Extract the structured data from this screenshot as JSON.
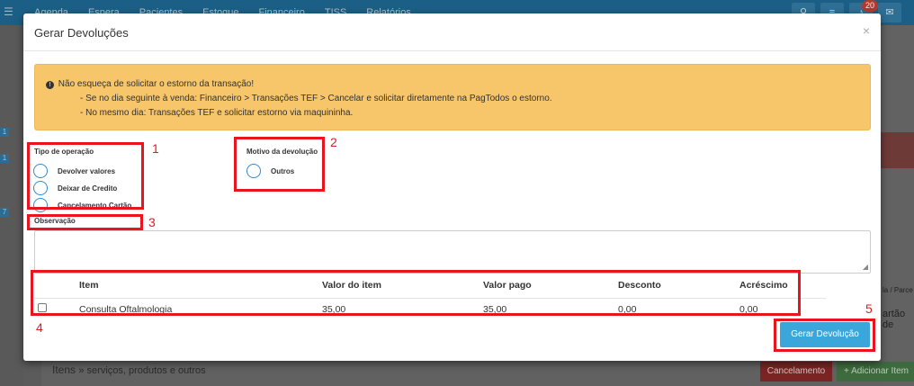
{
  "topbar": {
    "nav": [
      "Agenda",
      "Espera",
      "Pacientes",
      "Estoque",
      "Financeiro",
      "TISS",
      "Relatórios"
    ],
    "notification_count": "20"
  },
  "background": {
    "itens_label": "Itens",
    "itens_sub": "» serviços, produtos e outros",
    "cancel_label": "Cancelamento",
    "add_label": "+ Adicionar Item ▾",
    "right_text_1": "la / Parce",
    "right_text_2": "artão de",
    "sidebar_numbers": [
      "1",
      "1",
      "7"
    ]
  },
  "modal": {
    "title": "Gerar Devoluções",
    "close": "×"
  },
  "alert": {
    "line1": "Não esqueça de solicitar o estorno da transação!",
    "line2": "- Se no dia seguinte à venda: Financeiro > Transações TEF > Cancelar e solicitar diretamente na PagTodos o estorno.",
    "line3": "- No mesmo dia: Transações TEF e solicitar estorno via maquininha."
  },
  "operation": {
    "label": "Tipo de operação",
    "options": [
      "Devolver valores",
      "Deixar de Credito",
      "Cancelamento Cartão"
    ]
  },
  "reason": {
    "label": "Motivo da devolução",
    "options": [
      "Outros"
    ]
  },
  "observation": {
    "label": "Observação",
    "value": ""
  },
  "table": {
    "headers": [
      "Item",
      "Valor do item",
      "Valor pago",
      "Desconto",
      "Acréscimo"
    ],
    "rows": [
      {
        "item": "Consulta Oftalmologia",
        "valor_item": "35,00",
        "valor_pago": "35,00",
        "desconto": "0,00",
        "acrescimo": "0,00"
      }
    ]
  },
  "actions": {
    "generate_label": "Gerar Devolução"
  },
  "markers": [
    "1",
    "2",
    "3",
    "4",
    "5"
  ],
  "colors": {
    "alert_bg": "#f7c56a",
    "primary_button": "#3aa6da",
    "annotation_red": "#e8141e",
    "radio_border": "#2f8bd0"
  }
}
